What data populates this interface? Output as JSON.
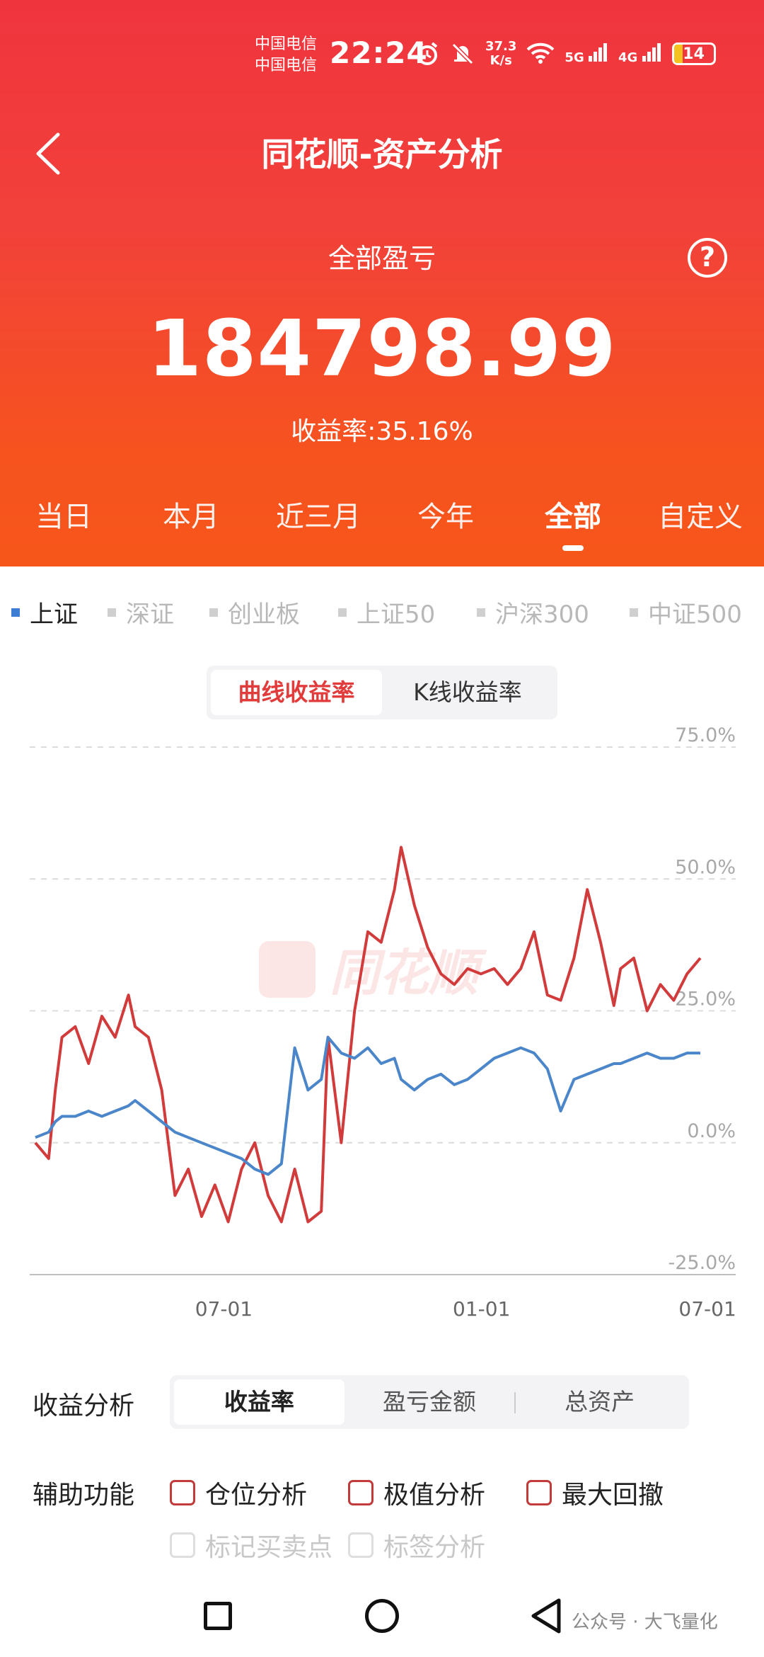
{
  "status_bar": {
    "carrier_1": "中国电信",
    "carrier_2": "中国电信",
    "time": "22:24",
    "net_speed_value": "37.3",
    "net_speed_unit": "K/s",
    "signal_1": "5G",
    "signal_2": "4G",
    "battery": "14",
    "icons": [
      "alarm-icon",
      "mute-icon",
      "wifi-icon",
      "signal-icon",
      "battery-icon"
    ]
  },
  "header": {
    "title": "同花顺-资产分析",
    "summary_label": "全部盈亏",
    "summary_value": "184798.99",
    "return_rate": "收益率:35.16%",
    "help_label": "?"
  },
  "period_tabs": [
    {
      "label": "当日",
      "active": false
    },
    {
      "label": "本月",
      "active": false
    },
    {
      "label": "近三月",
      "active": false
    },
    {
      "label": "今年",
      "active": false
    },
    {
      "label": "全部",
      "active": true
    },
    {
      "label": "自定义",
      "active": false
    }
  ],
  "index_options": [
    {
      "label": "上证",
      "active": true
    },
    {
      "label": "深证",
      "active": false
    },
    {
      "label": "创业板",
      "active": false
    },
    {
      "label": "上证50",
      "active": false
    },
    {
      "label": "沪深300",
      "active": false
    },
    {
      "label": "中证500",
      "active": false
    }
  ],
  "chart_toggle": {
    "options": [
      "曲线收益率",
      "K线收益率"
    ],
    "active_index": 0
  },
  "watermark": "同花顺",
  "chart_data": {
    "type": "line",
    "ylim": [
      -25,
      75
    ],
    "y_ticks": [
      "75.0%",
      "50.0%",
      "25.0%",
      "0.0%",
      "-25.0%"
    ],
    "y_tick_values": [
      75,
      50,
      25,
      0,
      -25
    ],
    "x_ticks": [
      "07-01",
      "01-01",
      "07-01"
    ],
    "x_tick_positions": [
      0.275,
      0.64,
      0.96
    ],
    "colors": {
      "portfolio": "#d23b3b",
      "index": "#4a86c9",
      "grid": "#dcdcdc"
    },
    "x": [
      0,
      0.02,
      0.03,
      0.04,
      0.06,
      0.08,
      0.1,
      0.12,
      0.14,
      0.15,
      0.17,
      0.19,
      0.21,
      0.23,
      0.25,
      0.27,
      0.29,
      0.31,
      0.33,
      0.35,
      0.37,
      0.39,
      0.41,
      0.43,
      0.44,
      0.46,
      0.48,
      0.5,
      0.52,
      0.54,
      0.55,
      0.57,
      0.59,
      0.61,
      0.63,
      0.65,
      0.67,
      0.69,
      0.71,
      0.73,
      0.75,
      0.77,
      0.79,
      0.81,
      0.83,
      0.85,
      0.87,
      0.88,
      0.9,
      0.92,
      0.94,
      0.96,
      0.98,
      1
    ],
    "series": [
      {
        "values": [
          0,
          -3,
          10,
          20,
          22,
          15,
          24,
          20,
          28,
          22,
          20,
          10,
          -10,
          -5,
          -14,
          -8,
          -15,
          -5,
          0,
          -10,
          -15,
          -5,
          -15,
          -13,
          20,
          0,
          25,
          40,
          38,
          48,
          56,
          45,
          37,
          32,
          30,
          33,
          32,
          33,
          30,
          33,
          40,
          28,
          27,
          35,
          48,
          38,
          26,
          33,
          35,
          25,
          30,
          27,
          32,
          35
        ]
      },
      {
        "values": [
          1,
          2,
          4,
          5,
          5,
          6,
          5,
          6,
          7,
          8,
          6,
          4,
          2,
          1,
          0,
          -1,
          -2,
          -3,
          -5,
          -6,
          -4,
          18,
          10,
          12,
          20,
          17,
          16,
          18,
          15,
          16,
          12,
          10,
          12,
          13,
          11,
          12,
          14,
          16,
          17,
          18,
          17,
          14,
          6,
          12,
          13,
          14,
          15,
          15,
          16,
          17,
          16,
          16,
          17,
          17
        ]
      }
    ]
  },
  "metric_row": {
    "label": "收益分析",
    "tabs": [
      "收益率",
      "盈亏金额",
      "总资产"
    ],
    "active_index": 0
  },
  "aux": {
    "label": "辅助功能",
    "options": [
      "仓位分析",
      "极值分析",
      "最大回撤"
    ],
    "disabled_options": [
      "标记买卖点",
      "标签分析"
    ]
  },
  "source_note": "公众号 · 大飞量化"
}
